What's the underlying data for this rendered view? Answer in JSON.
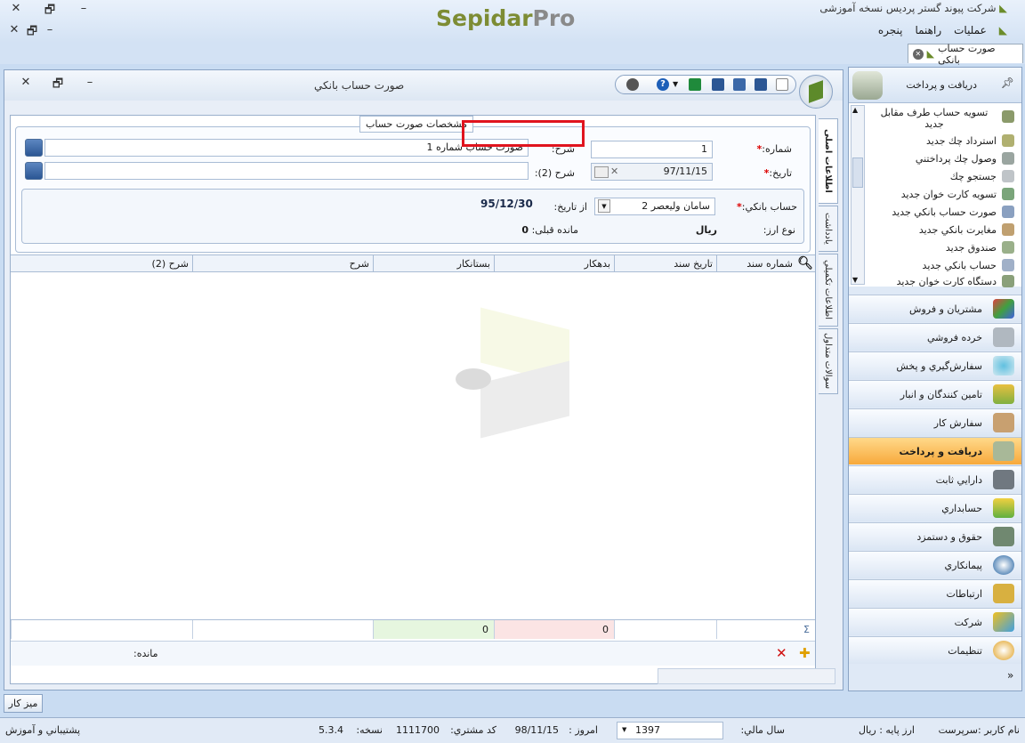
{
  "app": {
    "logo_main": "Sepidar",
    "logo_suffix": "Pro",
    "window_title": "شرکت پیوند گستر پردیس نسخه آموزشی",
    "menu": [
      "عملیات",
      "راهنما",
      "پنجره"
    ],
    "doc_tab": "صورت حساب بانکی"
  },
  "form": {
    "title": "صورت حساب بانكي",
    "legend": "مشخصات صورت حساب",
    "number_label": "شماره:",
    "number_value": "1",
    "date_label": "تاريخ:",
    "date_value": "97/11/15",
    "desc_label": "شرح:",
    "desc_value": "صورت حساب شماره 1",
    "desc2_label": "شرح (2):",
    "desc2_value": "",
    "bank_label": "حساب بانكي:",
    "bank_value": "سامان وليعصر 2",
    "from_date_label": "از تاريخ:",
    "from_date_value": "95/12/30",
    "currency_label": "نوع ارز:",
    "currency_value": "ريال",
    "prev_balance_label": "مانده قبلی:",
    "prev_balance_value": "0",
    "required_mark": "*"
  },
  "grid": {
    "columns": [
      "شماره سند",
      "تاريخ سند",
      "بدهكار",
      "بستانكار",
      "شرح",
      "شرح (2)"
    ],
    "total_debit": "0",
    "total_credit": "0",
    "balance_label": "مانده:"
  },
  "vertical_tabs": [
    "اطلاعات اصلی",
    "يادداشت",
    "اطلاعات تكميلي",
    "سوالات متداول"
  ],
  "sidebar": {
    "header": "دریافت و پرداخت",
    "items": [
      "تسويه حساب طرف مقابل جديد",
      "استرداد چك جديد",
      "وصول چك پرداختني",
      "جستجو چك",
      "تسويه كارت خوان جديد",
      "صورت حساب بانكي جديد",
      "مغايرت بانكي جديد",
      "صندوق جديد",
      "حساب بانكي جديد",
      "دستگاه كارت خوان جديد"
    ],
    "modules": [
      "مشتريان و فروش",
      "خرده فروشي",
      "سفارش‌گيري و پخش",
      "تامين كنندگان و انبار",
      "سفارش كار",
      "دريافت و پرداخت",
      "دارايي ثابت",
      "حسابداري",
      "حقوق و دستمزد",
      "پيمانكاري",
      "ارتباطات",
      "شركت",
      "تنظيمات"
    ],
    "active_module_index": 5
  },
  "desktop_button": "ميز كار",
  "status": {
    "user_label": "نام كاربر :",
    "user_value": "سرپرست",
    "base_currency_label": "ارز پايه :",
    "base_currency_value": "ريال",
    "fiscal_year_label": "سال مالي:",
    "fiscal_year_value": "1397",
    "today_label": "امروز :",
    "today_value": "98/11/15",
    "customer_code_label": "كد مشتري:",
    "customer_code_value": "1111700",
    "version_label": "نسخه:",
    "version_value": "5.3.4",
    "support": "پشتيباني و آموزش"
  }
}
